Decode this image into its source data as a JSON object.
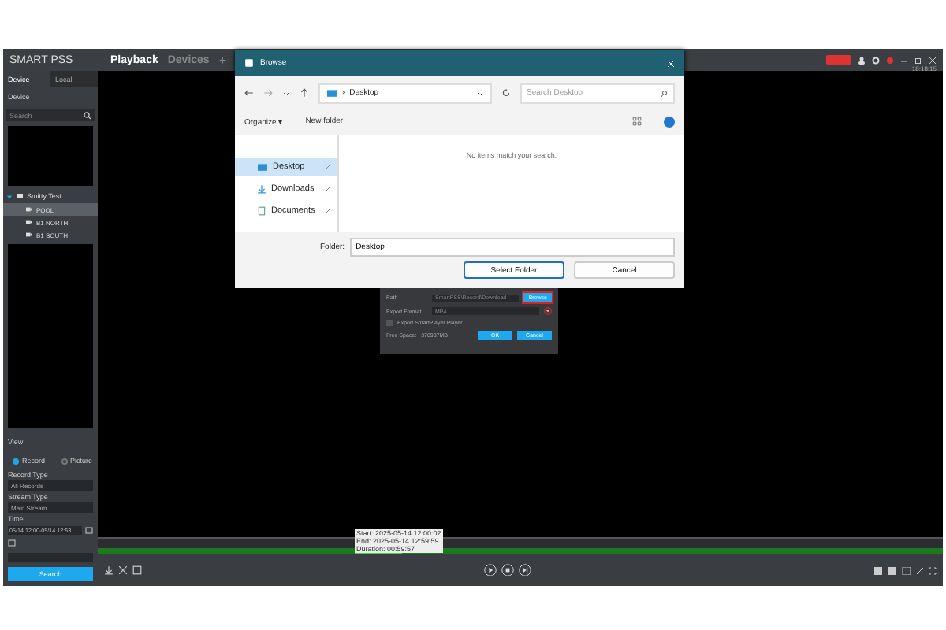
{
  "app": {
    "logo": "SMART PSS",
    "tabs": [
      {
        "label": "Playback",
        "selected": true
      },
      {
        "label": "Devices",
        "selected": false
      }
    ],
    "add_tab": "+",
    "clock": "18:18:15"
  },
  "sidebar": {
    "tabs": [
      {
        "label": "Device",
        "selected": true
      },
      {
        "label": "Local",
        "selected": false
      }
    ],
    "device_dropdown": "Device",
    "search": {
      "placeholder": "Search"
    },
    "tree": [
      {
        "label": "Smitty Test",
        "expanded": true,
        "children": [
          {
            "label": "POOL",
            "selected": true
          },
          {
            "label": "B1 NORTH",
            "selected": false
          },
          {
            "label": "B1 SOUTH",
            "selected": false
          }
        ]
      }
    ],
    "view_dropdown": "View",
    "source": [
      {
        "label": "Record",
        "selected": true
      },
      {
        "label": "Picture",
        "selected": false
      }
    ],
    "record_type": {
      "label": "Record Type",
      "value": "All Records"
    },
    "stream_type": {
      "label": "Stream Type",
      "value": "Main Stream"
    },
    "time": {
      "label": "Time",
      "value": "05/14 12:00-05/14 12:53"
    },
    "search_button": "Search"
  },
  "browse_dialog": {
    "title": "Browse",
    "breadcrumb_separator": "›",
    "breadcrumb": "Desktop",
    "search": {
      "placeholder": "Search Desktop"
    },
    "organize": "Organize ▾",
    "new_folder": "New folder",
    "empty_message": "No items match your search.",
    "nav": [
      {
        "label": "Desktop",
        "selected": true
      },
      {
        "label": "Downloads",
        "selected": false
      },
      {
        "label": "Documents",
        "selected": false
      }
    ],
    "folder_label": "Folder:",
    "folder_value": "Desktop",
    "buttons": [
      "Select Folder",
      "Cancel"
    ]
  },
  "export_panel": {
    "path_label": "Path",
    "path_value": "SmartPSS\\Record\\Download",
    "browse_button": "Browse",
    "format_label": "Export Format",
    "format_value": "MP4",
    "player_option": {
      "label": "Export SmartPlayer Player",
      "checked": false
    },
    "free_space_label": "Free Space:",
    "free_space_value": "378937MB",
    "buttons": [
      "OK",
      "Cancel"
    ]
  },
  "timeline": {
    "tooltip": [
      "Start: 2025-05-14 12:00:02",
      "End: 2025-05-14 12:59:59",
      "Duration: 00:59:57"
    ]
  }
}
